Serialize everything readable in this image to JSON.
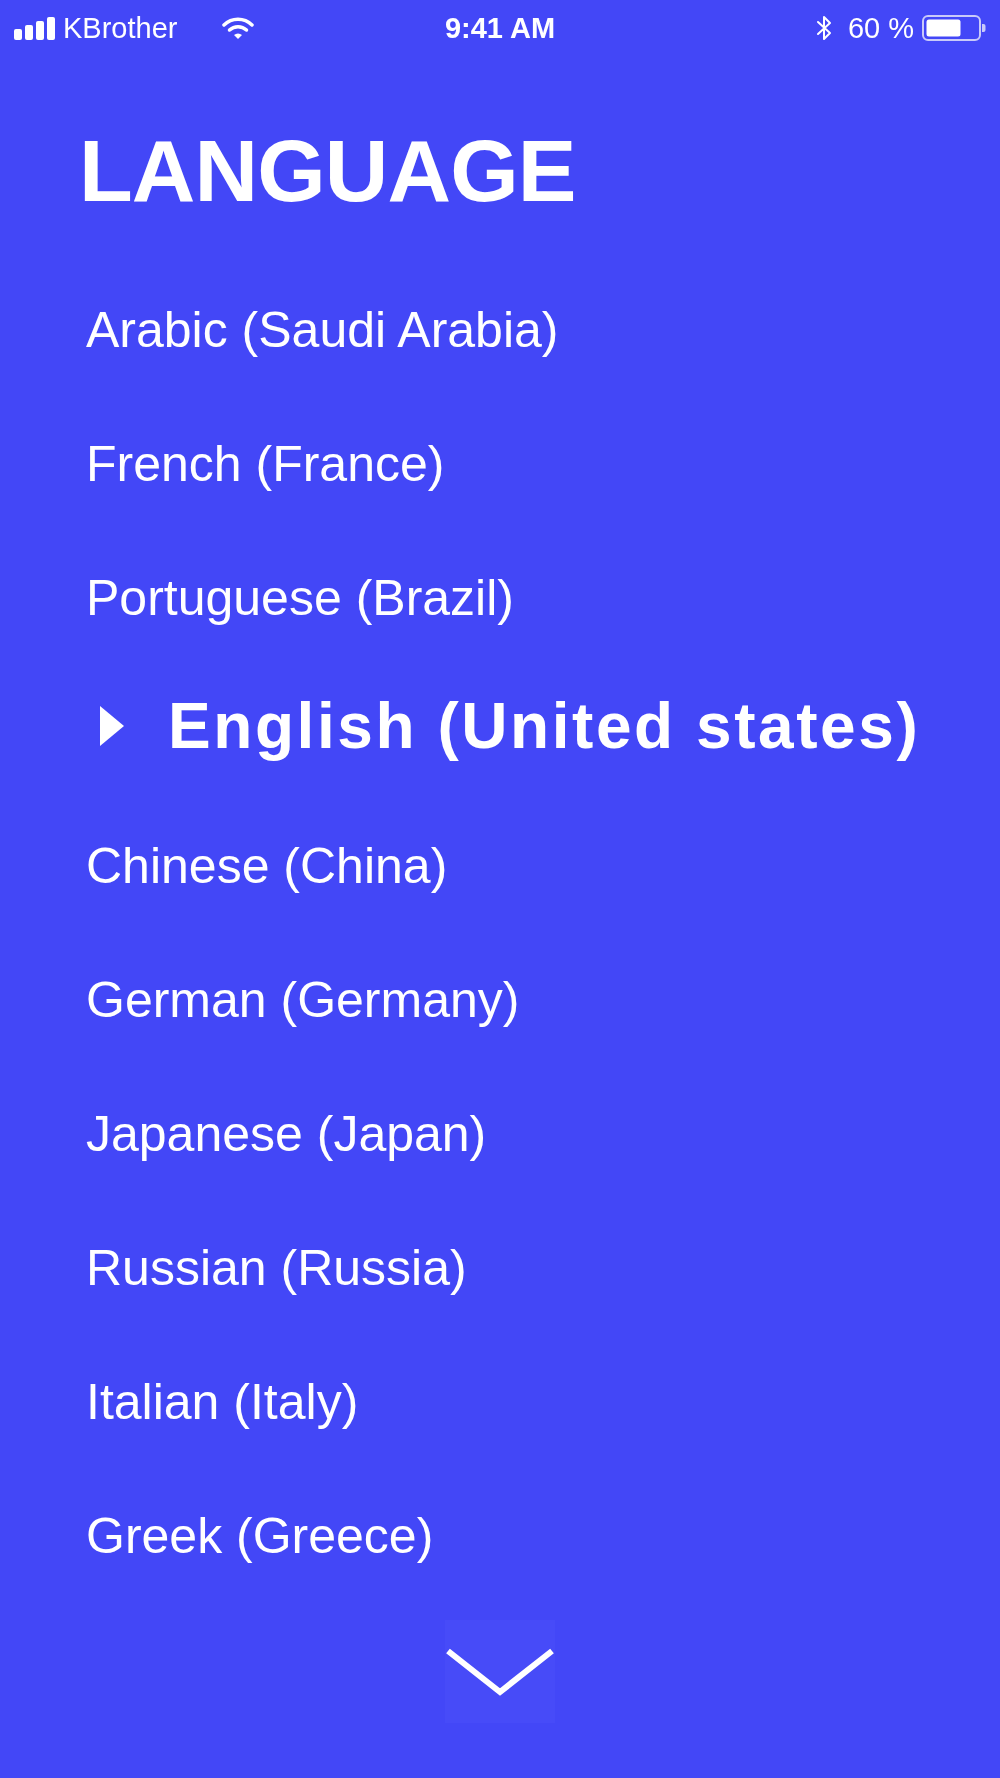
{
  "status_bar": {
    "carrier": "KBrother",
    "time": "9:41 AM",
    "battery": "60 %"
  },
  "title": "LANGUAGE",
  "languages": [
    {
      "label": "Arabic (Saudi Arabia)",
      "selected": false
    },
    {
      "label": "French (France)",
      "selected": false
    },
    {
      "label": "Portuguese (Brazil)",
      "selected": false
    },
    {
      "label": "English (United states)",
      "selected": true
    },
    {
      "label": "Chinese (China)",
      "selected": false
    },
    {
      "label": "German (Germany)",
      "selected": false
    },
    {
      "label": "Japanese (Japan)",
      "selected": false
    },
    {
      "label": "Russian (Russia)",
      "selected": false
    },
    {
      "label": "Italian (Italy)",
      "selected": false
    },
    {
      "label": "Greek (Greece)",
      "selected": false
    }
  ]
}
